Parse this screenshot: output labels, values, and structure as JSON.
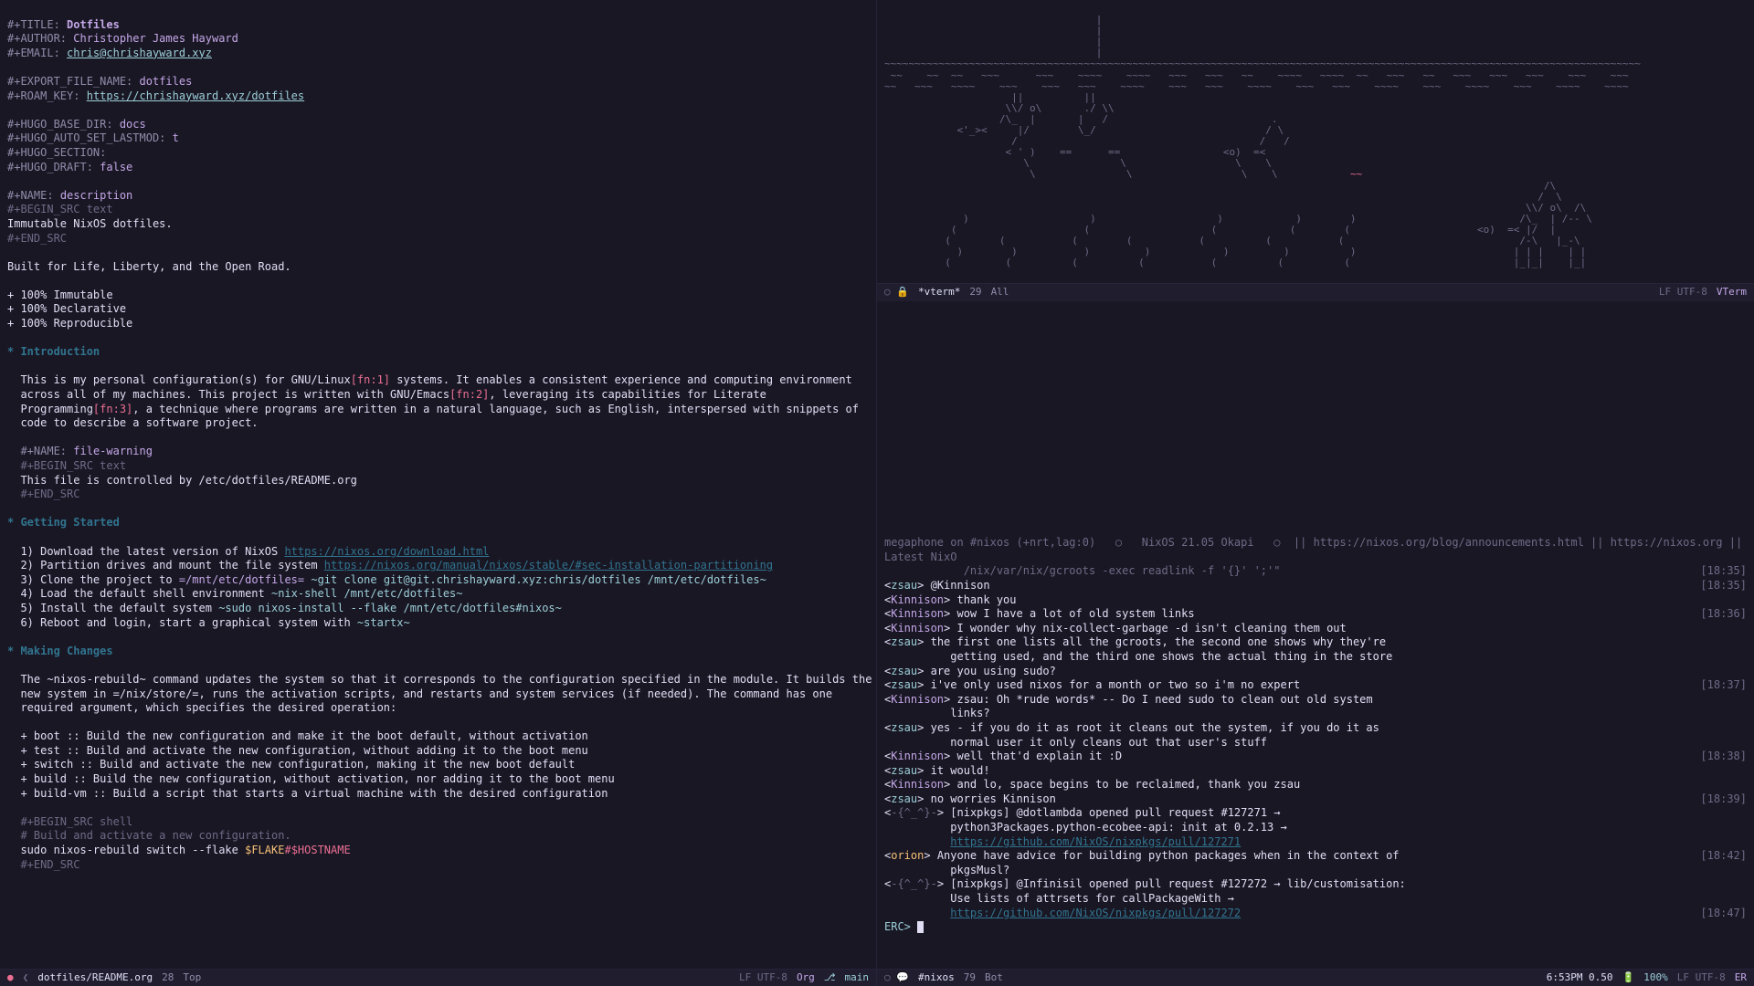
{
  "left": {
    "header": {
      "title_kw": "#+TITLE:",
      "title_val": "Dotfiles",
      "author_kw": "#+AUTHOR:",
      "author_val": "Christopher James Hayward",
      "email_kw": "#+EMAIL:",
      "email_val": "chris@chrishayward.xyz",
      "export_kw": "#+EXPORT_FILE_NAME:",
      "export_val": "dotfiles",
      "roam_kw": "#+ROAM_KEY:",
      "roam_val": "https://chrishayward.xyz/dotfiles",
      "hugo_base_kw": "#+HUGO_BASE_DIR:",
      "hugo_base_val": "docs",
      "hugo_lastmod_kw": "#+HUGO_AUTO_SET_LASTMOD:",
      "hugo_lastmod_val": "t",
      "hugo_section_kw": "#+HUGO_SECTION:",
      "hugo_section_val": "",
      "hugo_draft_kw": "#+HUGO_DRAFT:",
      "hugo_draft_val": "false"
    },
    "desc_block": {
      "name_kw": "#+NAME:",
      "name_val": "description",
      "begin": "#+BEGIN_SRC text",
      "body": "Immutable NixOS dotfiles.",
      "end": "#+END_SRC"
    },
    "tagline": "Built for Life, Liberty, and the Open Road.",
    "features": [
      "+ 100% Immutable",
      "+ 100% Declarative",
      "+ 100% Reproducible"
    ],
    "intro": {
      "heading": "* Introduction",
      "p1a": "  This is my personal configuration(s) for GNU/Linux",
      "fn1": "[fn:1]",
      "p1b": " systems. It enables a consistent experience and computing environment",
      "p2a": "  across all of my machines. This project is written with GNU/Emacs",
      "fn2": "[fn:2]",
      "p2b": ", leveraging its capabilities for Literate",
      "p3a": "  Programming",
      "fn3": "[fn:3]",
      "p3b": ", a technique where programs are written in a natural language, such as English, interspersed with snippets of",
      "p4": "  code to describe a software project."
    },
    "warn_block": {
      "name_kw": "  #+NAME:",
      "name_val": "file-warning",
      "begin": "  #+BEGIN_SRC text",
      "body": "  This file is controlled by /etc/dotfiles/README.org",
      "end": "  #+END_SRC"
    },
    "getting_started": {
      "heading": "* Getting Started",
      "l1a": "  1) Download the latest version of NixOS ",
      "l1b": "https://nixos.org/download.html",
      "l2a": "  2) Partition drives and mount the file system ",
      "l2b": "https://nixos.org/manual/nixos/stable/#sec-installation-partitioning",
      "l3a": "  3) Clone the project to ",
      "l3path": "=/mnt/etc/dotfiles=",
      "l3cmd": " ~git clone git@git.chrishayward.xyz:chris/dotfiles /mnt/etc/dotfiles~",
      "l4a": "  4) Load the default shell environment ",
      "l4cmd": "~nix-shell /mnt/etc/dotfiles~",
      "l5a": "  5) Install the default system ",
      "l5cmd": "~sudo nixos-install --flake /mnt/etc/dotfiles#nixos~",
      "l6a": "  6) Reboot and login, start a graphical system with ",
      "l6cmd": "~startx~"
    },
    "making_changes": {
      "heading": "* Making Changes",
      "p1": "  The ~nixos-rebuild~ command updates the system so that it corresponds to the configuration specified in the module. It builds the",
      "p2": "  new system in =/nix/store/=, runs the activation scripts, and restarts and system services (if needed). The command has one",
      "p3": "  required argument, which specifies the desired operation:",
      "items": [
        "  + boot :: Build the new configuration and make it the boot default, without activation",
        "  + test :: Build and activate the new configuration, without adding it to the boot menu",
        "  + switch :: Build and activate the new configuration, making it the new boot default",
        "  + build :: Build the new configuration, without activation, nor adding it to the boot menu",
        "  + build-vm :: Build a script that starts a virtual machine with the desired configuration"
      ],
      "src_begin": "  #+BEGIN_SRC shell",
      "src_comment": "  # Build and activate a new configuration.",
      "src_body1": "  sudo nixos-rebuild switch --flake ",
      "src_var": "$FLAKE",
      "src_hash": "#",
      "src_host": "$HOSTNAME",
      "src_end": "  #+END_SRC"
    },
    "modeline": {
      "modified": "●",
      "back_icon": "❮",
      "buffer_name": "dotfiles/README.org",
      "line": "28",
      "position": "Top",
      "encoding": "LF UTF-8",
      "mode": "Org",
      "vc_icon": "⎇",
      "vc_branch": "main"
    }
  },
  "right_top": {
    "modeline": {
      "icons": "○ 🔒",
      "buffer_name": "*vterm*",
      "line": "29",
      "position": "All",
      "encoding": "LF UTF-8",
      "mode": "VTerm"
    }
  },
  "irc": {
    "topic1": "megaphone on #nixos (+nrt,lag:0)   ○   NixOS 21.05 Okapi   ○  || https://nixos.org/blog/announcements.html || https://nixos.org || Latest NixO",
    "topic2": "            /nix/var/nix/gcroots -exec readlink -f '{}' ';'\"",
    "lines": [
      {
        "time": "[18:35]",
        "nick": "zsau",
        "cls": "irc-nick1",
        "text": "@Kinnison"
      },
      {
        "time": "",
        "nick": "Kinnison",
        "cls": "irc-nick2",
        "text": "thank you"
      },
      {
        "time": "[18:36]",
        "nick": "Kinnison",
        "cls": "irc-nick2",
        "text": "wow I have a lot of old system links"
      },
      {
        "time": "",
        "nick": "Kinnison",
        "cls": "irc-nick2",
        "text": "I wonder why nix-collect-garbage -d isn't cleaning them out"
      },
      {
        "time": "",
        "nick": "zsau",
        "cls": "irc-nick1",
        "text": "the first one lists all the gcroots, the second one shows why they're"
      },
      {
        "time": "",
        "nick": "",
        "cls": "",
        "text": "          getting used, and the third one shows the actual thing in the store"
      },
      {
        "time": "",
        "nick": "zsau",
        "cls": "irc-nick1",
        "text": "are you using sudo?"
      },
      {
        "time": "[18:37]",
        "nick": "zsau",
        "cls": "irc-nick1",
        "text": "i've only used nixos for a month or two so i'm no expert"
      },
      {
        "time": "",
        "nick": "Kinnison",
        "cls": "irc-nick2",
        "text": "zsau: Oh *rude words* -- Do I need sudo to clean out old system"
      },
      {
        "time": "",
        "nick": "",
        "cls": "",
        "text": "          links?"
      },
      {
        "time": "",
        "nick": "zsau",
        "cls": "irc-nick1",
        "text": "yes - if you do it as root it cleans out the system, if you do it as"
      },
      {
        "time": "",
        "nick": "",
        "cls": "",
        "text": "          normal user it only cleans out that user's stuff"
      },
      {
        "time": "[18:38]",
        "nick": "Kinnison",
        "cls": "irc-nick2",
        "text": "well that'd explain it :D"
      },
      {
        "time": "",
        "nick": "zsau",
        "cls": "irc-nick1",
        "text": "it would!"
      },
      {
        "time": "",
        "nick": "Kinnison",
        "cls": "irc-nick2",
        "text": "and lo, space begins to be reclaimed, thank you zsau"
      },
      {
        "time": "[18:39]",
        "nick": "zsau",
        "cls": "irc-nick1",
        "text": "no worries Kinnison"
      },
      {
        "time": "",
        "nick": "-{^_^}-",
        "cls": "irc-system",
        "text": "[nixpkgs] @dotlambda opened pull request #127271 →"
      },
      {
        "time": "",
        "nick": "",
        "cls": "",
        "text": "          python3Packages.python-ecobee-api: init at 0.2.13 →"
      },
      {
        "time": "",
        "nick": "",
        "cls": "",
        "link": "https://github.com/NixOS/nixpkgs/pull/127271"
      },
      {
        "time": "[18:42]",
        "nick": "orion",
        "cls": "irc-nick3",
        "text": "Anyone have advice for building python packages when in the context of"
      },
      {
        "time": "",
        "nick": "",
        "cls": "",
        "text": "          pkgsMusl?"
      },
      {
        "time": "",
        "nick": "-{^_^}-",
        "cls": "irc-system",
        "text": "[nixpkgs] @Infinisil opened pull request #127272 → lib/customisation:"
      },
      {
        "time": "",
        "nick": "",
        "cls": "",
        "text": "          Use lists of attrsets for callPackageWith →"
      },
      {
        "time": "[18:47]",
        "nick": "",
        "cls": "",
        "link": "https://github.com/NixOS/nixpkgs/pull/127272"
      }
    ],
    "prompt": "ERC>",
    "modeline": {
      "icons": "○ 💬",
      "buffer_name": "#nixos",
      "line": "79",
      "position": "Bot",
      "clock": "6:53PM 0.50",
      "battery_icon": "🔋",
      "battery_pct": "100%",
      "encoding": "LF UTF-8",
      "mode": "ER"
    }
  }
}
